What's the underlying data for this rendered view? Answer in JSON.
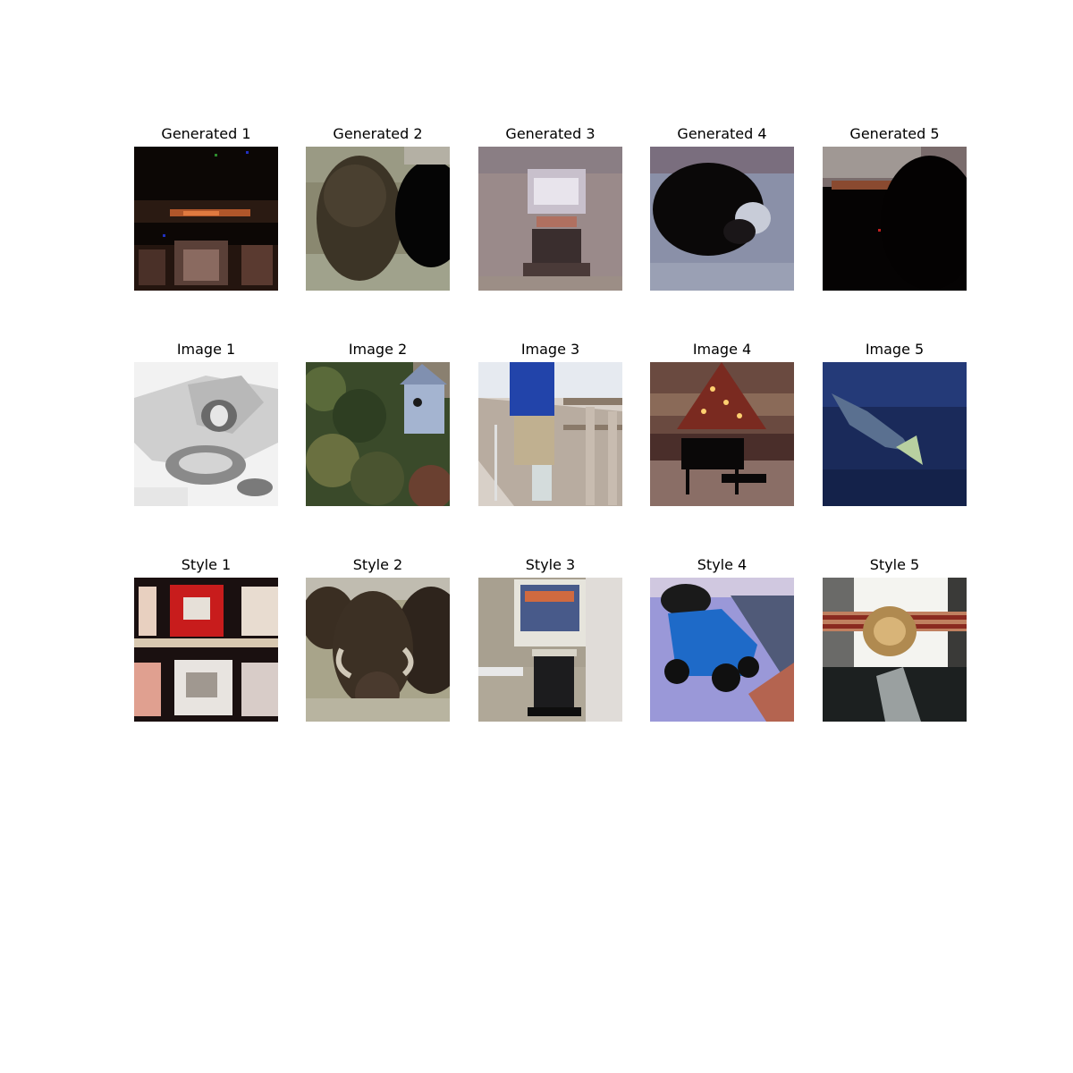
{
  "grid": {
    "generated": [
      "Generated 1",
      "Generated 2",
      "Generated 3",
      "Generated 4",
      "Generated 5"
    ],
    "images": [
      "Image 1",
      "Image 2",
      "Image 3",
      "Image 4",
      "Image 5"
    ],
    "styles": [
      "Style 1",
      "Style 2",
      "Style 3",
      "Style 4",
      "Style 5"
    ]
  }
}
